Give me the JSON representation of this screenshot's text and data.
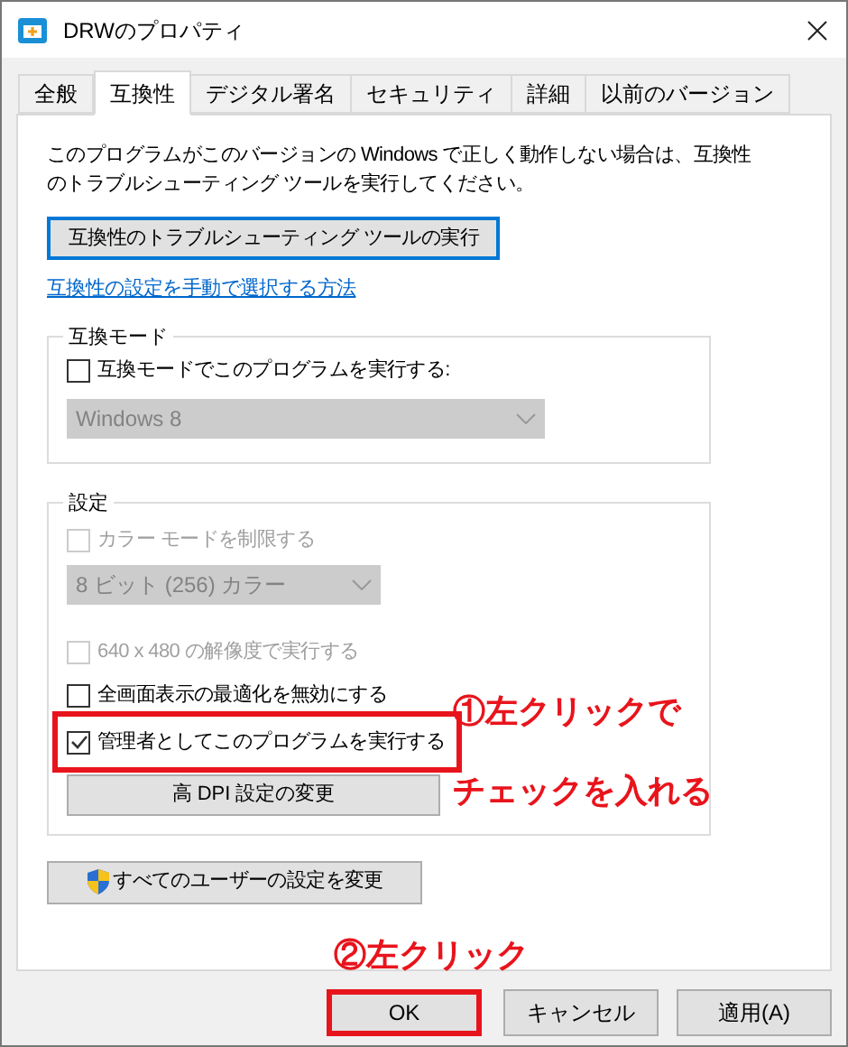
{
  "window": {
    "title": "DRWのプロパティ"
  },
  "tabs": [
    {
      "label": "全般",
      "selected": false
    },
    {
      "label": "互換性",
      "selected": true
    },
    {
      "label": "デジタル署名",
      "selected": false
    },
    {
      "label": "セキュリティ",
      "selected": false
    },
    {
      "label": "詳細",
      "selected": false
    },
    {
      "label": "以前のバージョン",
      "selected": false
    }
  ],
  "intro": "このプログラムがこのバージョンの Windows で正しく動作しない場合は、互換性のトラブルシューティング ツールを実行してください。",
  "troubleshoot_button": "互換性のトラブルシューティング ツールの実行",
  "manual_link": "互換性の設定を手動で選択する方法",
  "compat_mode": {
    "label": "互換モード",
    "checkbox": {
      "label": "互換モードでこのプログラムを実行する:",
      "checked": false
    },
    "dropdown": {
      "value": "Windows 8",
      "disabled": true
    }
  },
  "settings": {
    "label": "設定",
    "items": [
      {
        "kind": "checkbox",
        "label": "カラー モードを制限する",
        "checked": false,
        "disabled": true,
        "highlighted": false
      },
      {
        "kind": "dropdown",
        "value": "8 ビット (256) カラー",
        "disabled": true
      },
      {
        "kind": "checkbox",
        "label": "640 x 480 の解像度で実行する",
        "checked": false,
        "disabled": true,
        "highlighted": false
      },
      {
        "kind": "checkbox",
        "label": "全画面表示の最適化を無効にする",
        "checked": false,
        "disabled": false,
        "highlighted": false
      },
      {
        "kind": "checkbox",
        "label": "管理者としてこのプログラムを実行する",
        "checked": true,
        "disabled": false,
        "highlighted": true
      },
      {
        "kind": "button",
        "label": "高 DPI 設定の変更"
      }
    ]
  },
  "all_users_button": "すべてのユーザーの設定を変更",
  "buttons": [
    {
      "label": "OK",
      "highlighted": true
    },
    {
      "label": "キャンセル",
      "highlighted": false
    },
    {
      "label": "適用(A)",
      "highlighted": false
    }
  ],
  "annotations": [
    {
      "text": "①左クリックで"
    },
    {
      "text": "チェックを入れる"
    },
    {
      "text": "②左クリック"
    }
  ]
}
